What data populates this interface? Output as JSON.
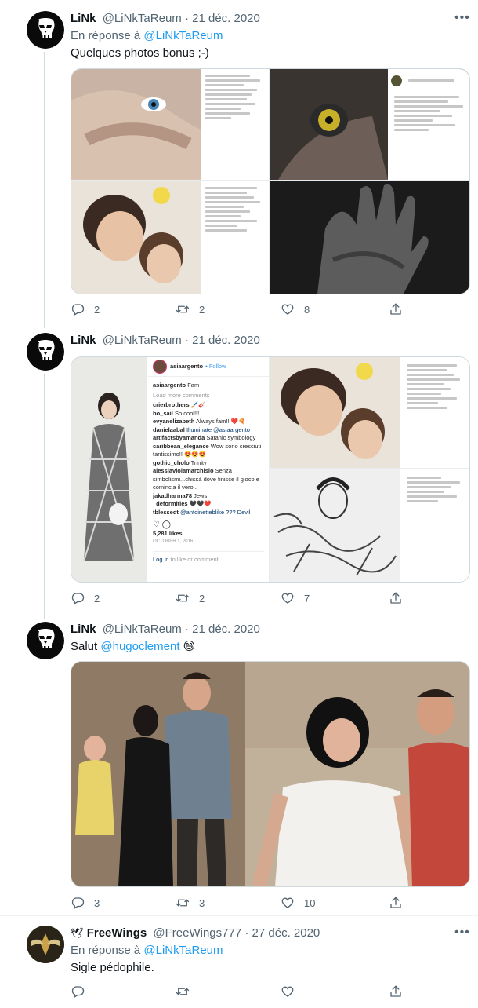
{
  "tweets": [
    {
      "name": "LiNk",
      "handle": "@LiNkTaReum",
      "date": "21 déc. 2020",
      "reply_prefix": "En réponse à",
      "reply_to": "@LiNkTaReum",
      "text": "Quelques photos bonus ;-)",
      "stats": {
        "replies": "2",
        "retweets": "2",
        "likes": "8"
      }
    },
    {
      "name": "LiNk",
      "handle": "@LiNkTaReum",
      "date": "21 déc. 2020",
      "stats": {
        "replies": "2",
        "retweets": "2",
        "likes": "7"
      },
      "ig": {
        "user": "asiaargento",
        "follow": "• Follow",
        "caption": "Fam",
        "load_more": "Load more comments",
        "comments": [
          {
            "user": "crierbrothers",
            "text": "🖌️🎸"
          },
          {
            "user": "bo_sail",
            "text": "So cool!!!"
          },
          {
            "user": "evyanelizabeth",
            "text": "Always fam!! ❤️🍕"
          },
          {
            "user": "danielaabal",
            "text": "Illuminate @asiaargento"
          },
          {
            "user": "artifactsbyamanda",
            "text": "Satanic symbology"
          },
          {
            "user": "caribbean_elegance",
            "text": "Wow sono cresciuti tantissimo!! 😍😍😍"
          },
          {
            "user": "gothic_cholo",
            "text": "Trinity"
          },
          {
            "user": "alessiaviolamarchisio",
            "text": "Senza simbolismi...chissà dove finisce il gioco e comincia il vero.."
          },
          {
            "user": "jakadharma78",
            "text": "Jews"
          },
          {
            "user": "_deformities",
            "text": "🖤🖤❤️"
          },
          {
            "user": "tblessedt",
            "text": "@antoinetteblike ??? Devil"
          }
        ],
        "likes": "5,281 likes",
        "date": "OCTOBER 1, 2016",
        "login_prefix": "Log in",
        "login_suffix": "to like or comment."
      }
    },
    {
      "name": "LiNk",
      "handle": "@LiNkTaReum",
      "date": "21 déc. 2020",
      "text_prefix": "Salut",
      "mention": "@hugoclement",
      "emoji": "😄",
      "stats": {
        "replies": "3",
        "retweets": "3",
        "likes": "10"
      }
    },
    {
      "name": "FreeWings",
      "name_icon": "🕊",
      "handle": "@FreeWings777",
      "date": "27 déc. 2020",
      "reply_prefix": "En réponse à",
      "reply_to": "@LiNkTaReum",
      "text": "Sigle pédophile."
    }
  ],
  "separator": "·",
  "more_glyph": "•••"
}
